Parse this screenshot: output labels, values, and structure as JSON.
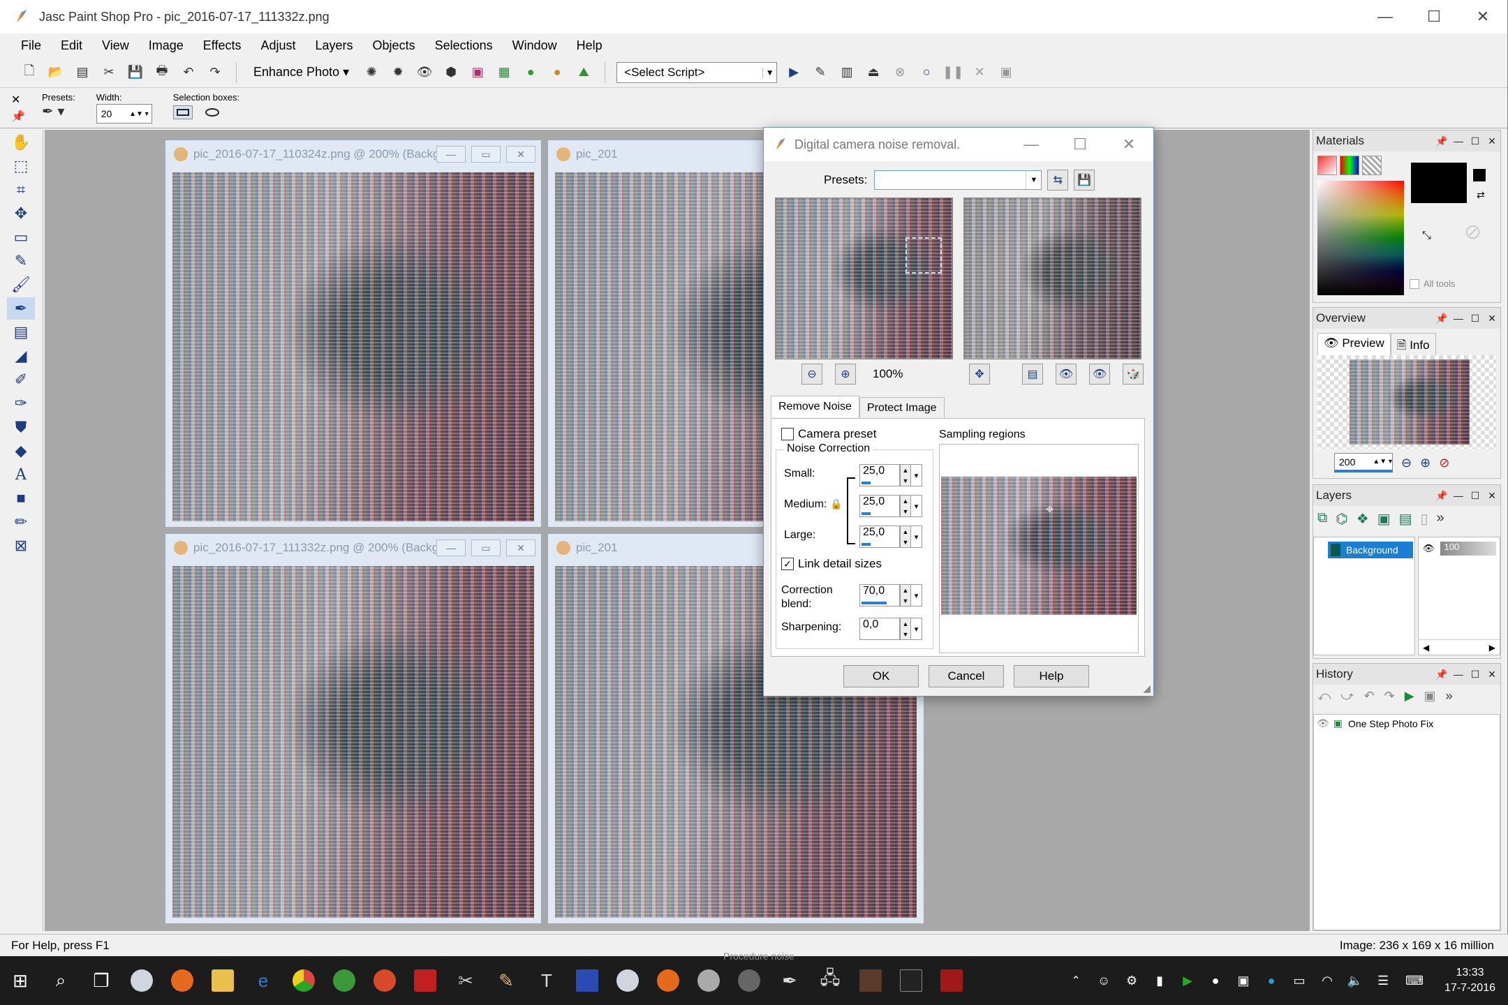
{
  "window": {
    "title": "Jasc Paint Shop Pro - pic_2016-07-17_111332z.png"
  },
  "menu": [
    "File",
    "Edit",
    "View",
    "Image",
    "Effects",
    "Adjust",
    "Layers",
    "Objects",
    "Selections",
    "Window",
    "Help"
  ],
  "toolbar": {
    "enhance_label": "Enhance Photo",
    "script_placeholder": "<Select Script>"
  },
  "tool_options": {
    "presets_label": "Presets:",
    "width_label": "Width:",
    "width_value": "20",
    "selection_boxes_label": "Selection boxes:"
  },
  "documents": [
    {
      "title": "pic_2016-07-17_110324z.png @ 200% (Background)"
    },
    {
      "title": "pic_201"
    },
    {
      "title": "pic_2016-07-17_111332z.png @ 200% (Background)"
    },
    {
      "title": "pic_201"
    }
  ],
  "dialog": {
    "title": "Digital camera noise removal.",
    "presets_label": "Presets:",
    "zoom": "100%",
    "tabs": [
      "Remove Noise",
      "Protect Image"
    ],
    "camera_preset_label": "Camera preset",
    "noise_correction_label": "Noise Correction",
    "small_label": "Small:",
    "small_value": "25,0",
    "small_level": 25,
    "medium_label": "Medium:",
    "medium_value": "25,0",
    "medium_level": 25,
    "large_label": "Large:",
    "large_value": "25,0",
    "large_level": 25,
    "link_label": "Link detail sizes",
    "blend_label_1": "Correction",
    "blend_label_2": "blend:",
    "blend_value": "70,0",
    "blend_level": 70,
    "sharpening_label": "Sharpening:",
    "sharpening_value": "0,0",
    "sharpening_level": 0,
    "sampling_label": "Sampling regions",
    "ok": "OK",
    "cancel": "Cancel",
    "help": "Help"
  },
  "materials": {
    "title": "Materials",
    "all_tools": "All tools"
  },
  "overview": {
    "title": "Overview",
    "tab_preview": "Preview",
    "tab_info": "Info",
    "zoom_value": "200"
  },
  "layers": {
    "title": "Layers",
    "layer_name": "Background",
    "opacity": "100"
  },
  "history": {
    "title": "History",
    "item": "One Step Photo Fix"
  },
  "status": {
    "help": "For Help, press F1",
    "image_info": "Image:  236 x 169 x 16 million",
    "overflow_text": "Procedure noise"
  },
  "taskbar": {
    "time": "13:33",
    "date": "17-7-2016"
  }
}
